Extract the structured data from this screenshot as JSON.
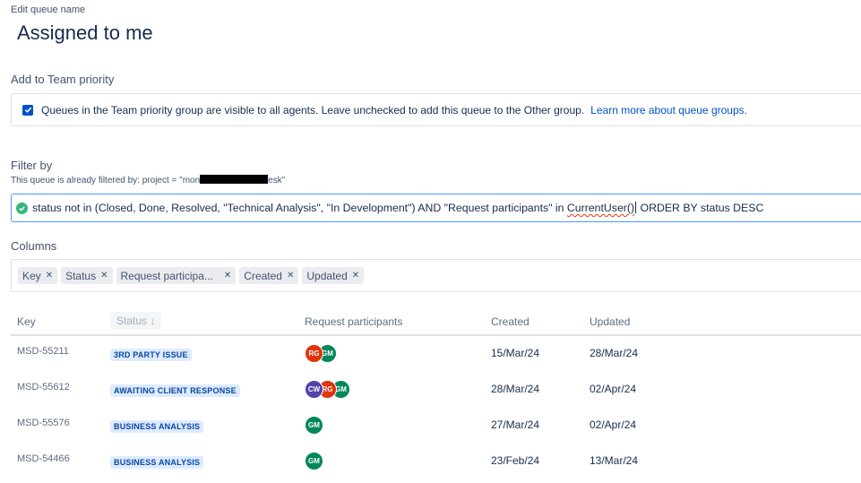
{
  "header": {
    "edit_label": "Edit queue name",
    "queue_name": "Assigned to me"
  },
  "team_priority": {
    "heading": "Add to Team priority",
    "checked": true,
    "description": "Queues in the Team priority group are visible to all agents. Leave unchecked to add this queue to the Other group.",
    "link": "Learn more about queue groups."
  },
  "filter": {
    "heading": "Filter by",
    "note_prefix": "This queue is already filtered by:  project = \"mon",
    "note_suffix": "esk\"",
    "jql_part1": "status not in (Closed, Done, Resolved, \"Technical Analysis\", \"In Development\") AND \"Request participants\" in ",
    "jql_func": "CurrentUser()",
    "jql_part2": " ORDER BY status DESC",
    "valid_color": "#36b37e"
  },
  "columns": {
    "heading": "Columns",
    "chips": [
      "Key",
      "Status",
      "Request participa...",
      "Created",
      "Updated"
    ]
  },
  "table": {
    "headers": {
      "key": "Key",
      "status": "Status ↓",
      "participants": "Request participants",
      "created": "Created",
      "updated": "Updated"
    },
    "rows": [
      {
        "key": "MSD-55211",
        "status": "3RD PARTY ISSUE",
        "participants": [
          {
            "initials": "RG",
            "color": "#de350b"
          },
          {
            "initials": "GM",
            "color": "#00875a"
          }
        ],
        "created": "15/Mar/24",
        "updated": "28/Mar/24"
      },
      {
        "key": "MSD-55612",
        "status": "AWAITING CLIENT RESPONSE",
        "participants": [
          {
            "initials": "CW",
            "color": "#5243aa"
          },
          {
            "initials": "RG",
            "color": "#de350b"
          },
          {
            "initials": "GM",
            "color": "#00875a"
          }
        ],
        "created": "28/Mar/24",
        "updated": "02/Apr/24"
      },
      {
        "key": "MSD-55576",
        "status": "BUSINESS ANALYSIS",
        "participants": [
          {
            "initials": "GM",
            "color": "#00875a"
          }
        ],
        "created": "27/Mar/24",
        "updated": "02/Apr/24"
      },
      {
        "key": "MSD-54466",
        "status": "BUSINESS ANALYSIS",
        "participants": [
          {
            "initials": "GM",
            "color": "#00875a"
          }
        ],
        "created": "23/Feb/24",
        "updated": "13/Mar/24"
      }
    ]
  }
}
